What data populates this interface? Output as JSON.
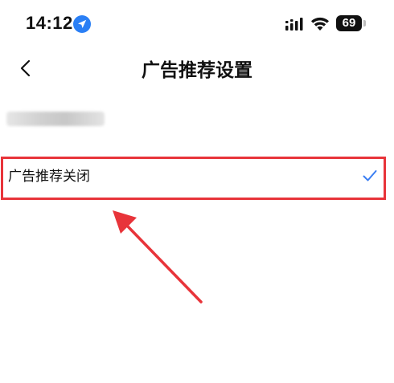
{
  "status_bar": {
    "time": "14:12",
    "battery": "69",
    "icons": [
      "location-arrow-icon",
      "cellular-signal-icon",
      "wifi-icon",
      "battery-icon"
    ]
  },
  "nav": {
    "back_icon": "chevron-left-icon",
    "title": "广告推荐设置"
  },
  "options": [
    {
      "label": "广告推荐关闭",
      "selected": true,
      "check_icon": "checkmark-icon"
    }
  ],
  "colors": {
    "accent": "#3a7ef2",
    "annotation": "#e8343a",
    "text": "#111111",
    "background": "#ffffff"
  }
}
